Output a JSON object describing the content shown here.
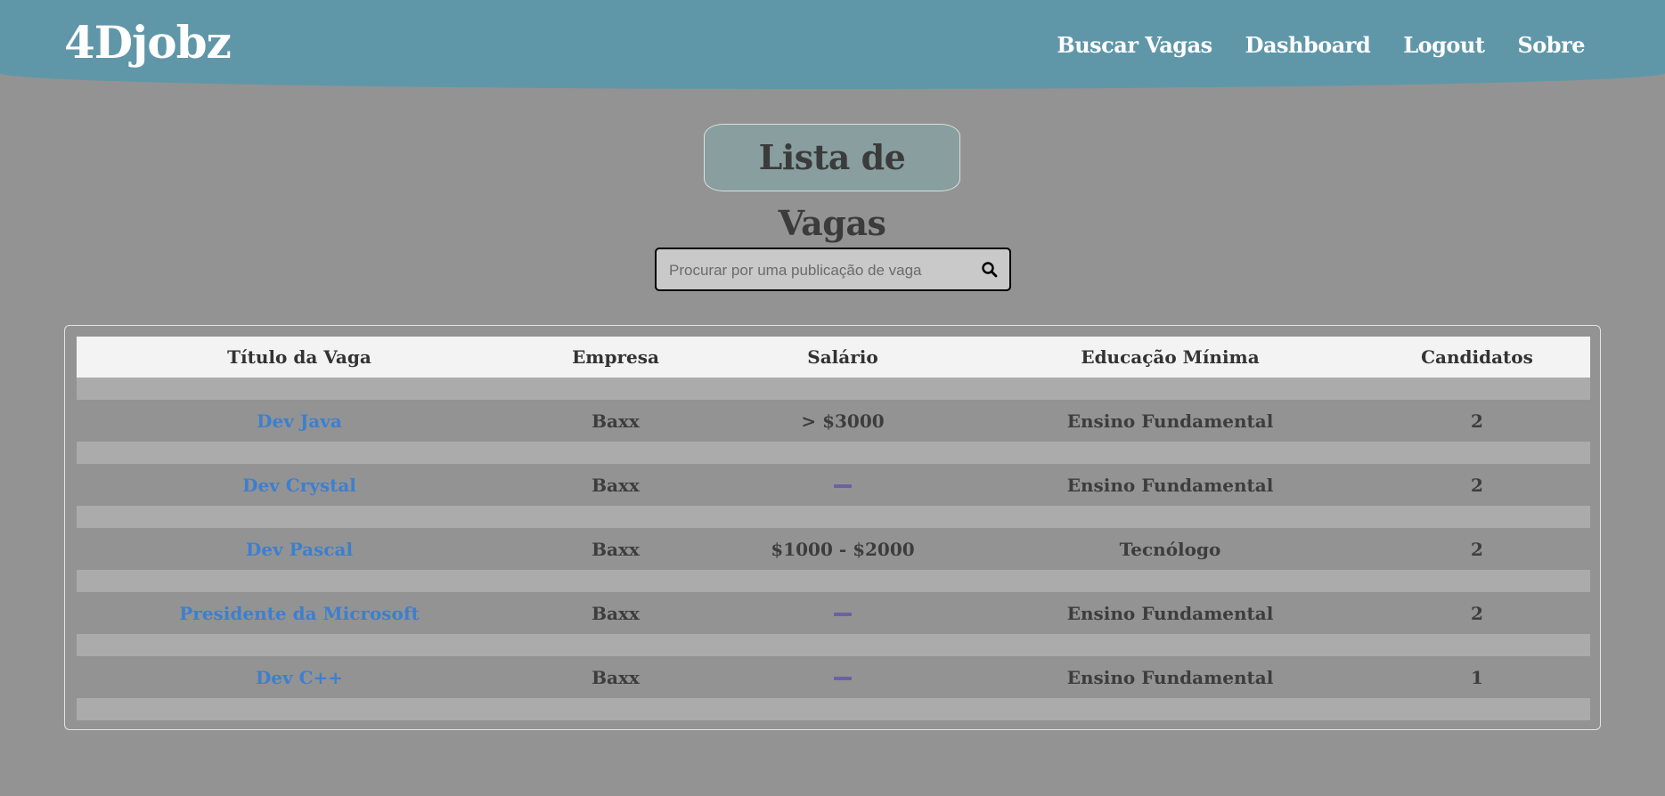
{
  "header": {
    "logo": "4Djobz",
    "nav": [
      "Buscar Vagas",
      "Dashboard",
      "Logout",
      "Sobre"
    ]
  },
  "page_title": "Lista de Vagas",
  "search": {
    "placeholder": "Procurar por uma publicação de vaga",
    "value": "",
    "icon": "search-icon"
  },
  "table": {
    "columns": [
      "Título da Vaga",
      "Empresa",
      "Salário",
      "Educação Mínima",
      "Candidatos"
    ],
    "rows": [
      {
        "title": "Dev Java",
        "company": "Baxx",
        "salary": "> $3000",
        "education": "Ensino Fundamental",
        "candidates": "2"
      },
      {
        "title": "Dev Crystal",
        "company": "Baxx",
        "salary": "",
        "education": "Ensino Fundamental",
        "candidates": "2"
      },
      {
        "title": "Dev Pascal",
        "company": "Baxx",
        "salary": "$1000 - $2000",
        "education": "Tecnólogo",
        "candidates": "2"
      },
      {
        "title": "Presidente da Microsoft",
        "company": "Baxx",
        "salary": "",
        "education": "Ensino Fundamental",
        "candidates": "2"
      },
      {
        "title": "Dev C++",
        "company": "Baxx",
        "salary": "",
        "education": "Ensino Fundamental",
        "candidates": "1"
      }
    ]
  },
  "colors": {
    "header_bg": "#6097a8",
    "page_bg": "#939393",
    "link": "#3d7fcf",
    "empty_salary_dash": "#6a62a2"
  }
}
